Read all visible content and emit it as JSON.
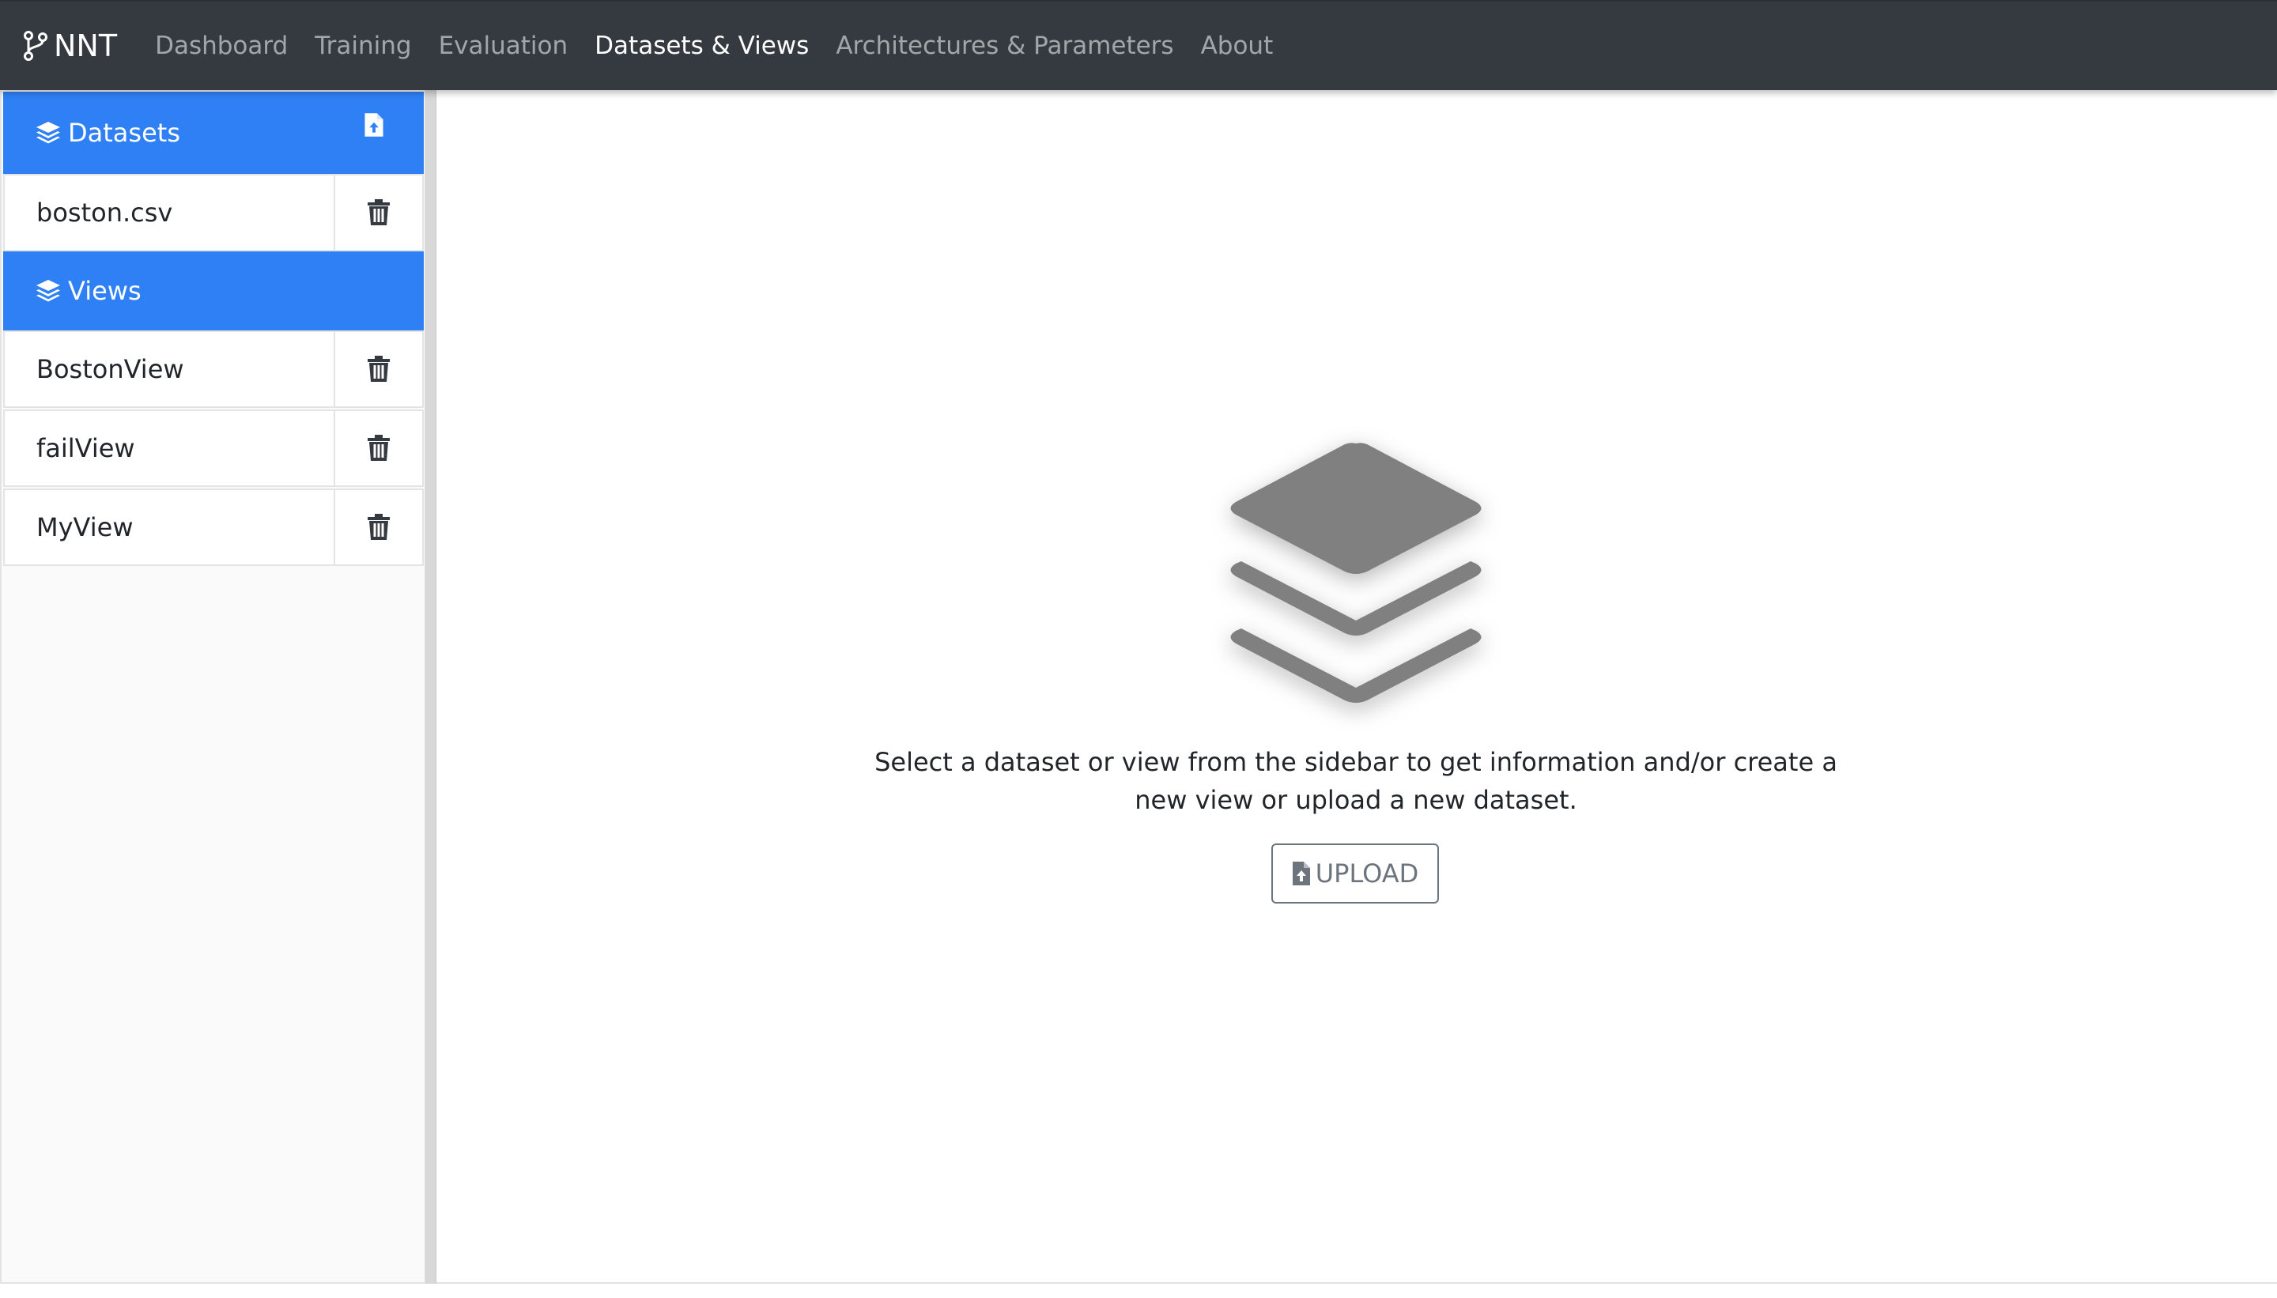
{
  "navbar": {
    "brand": "NNT",
    "brand_icon": "code-branch-icon",
    "items": [
      {
        "label": "Dashboard",
        "active": false
      },
      {
        "label": "Training",
        "active": false
      },
      {
        "label": "Evaluation",
        "active": false
      },
      {
        "label": "Datasets & Views",
        "active": true
      },
      {
        "label": "Architectures & Parameters",
        "active": false
      },
      {
        "label": "About",
        "active": false
      }
    ]
  },
  "sidebar": {
    "datasets_header": {
      "label": "Datasets",
      "icon": "layers-icon",
      "action_icon": "file-upload-icon"
    },
    "datasets": [
      {
        "label": "boston.csv",
        "delete_icon": "trash-icon"
      }
    ],
    "views_header": {
      "label": "Views",
      "icon": "layers-icon"
    },
    "views": [
      {
        "label": "BostonView",
        "delete_icon": "trash-icon"
      },
      {
        "label": "failView",
        "delete_icon": "trash-icon"
      },
      {
        "label": "MyView",
        "delete_icon": "trash-icon"
      }
    ]
  },
  "main": {
    "placeholder_icon": "layers-icon",
    "message": "Select a dataset or view from the sidebar to get information and/or create a new view or upload a new dataset.",
    "upload_label": "UPLOAD",
    "upload_icon": "file-upload-icon"
  },
  "colors": {
    "navbar_bg": "#343a40",
    "accent": "#2f80f5",
    "placeholder_icon": "#808080",
    "secondary": "#6c757d"
  }
}
